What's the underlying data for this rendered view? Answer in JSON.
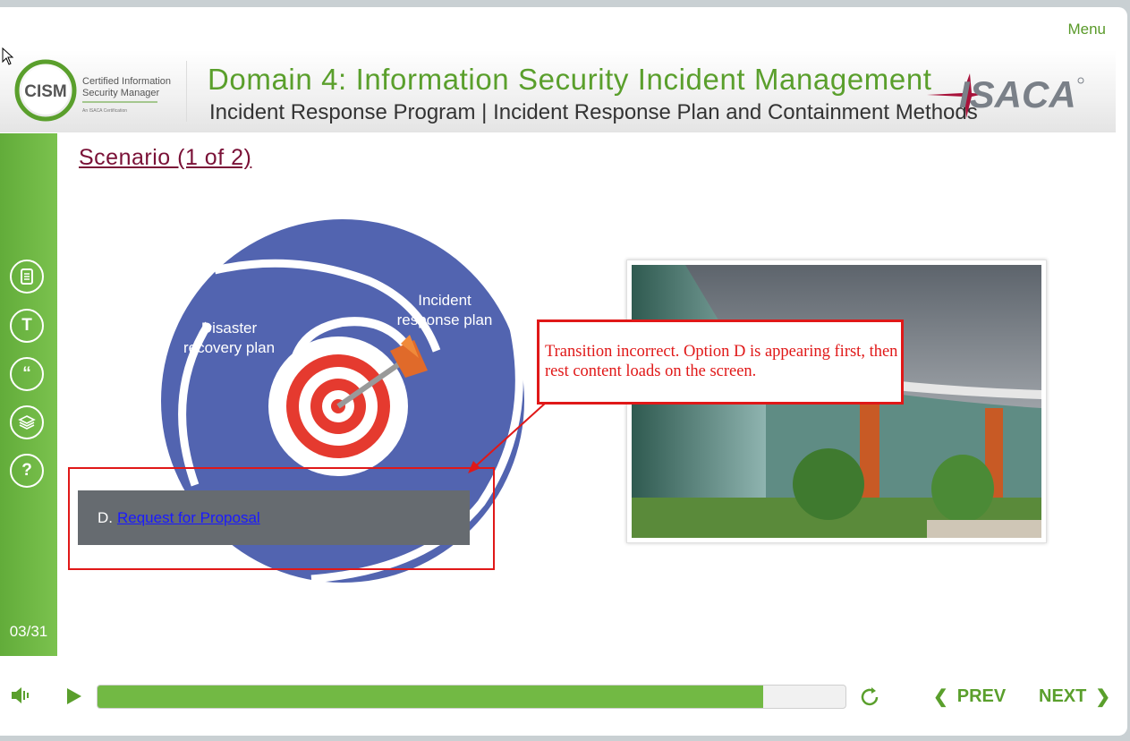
{
  "header": {
    "menu_label": "Menu",
    "logo_acronym": "CISM",
    "logo_line1": "Certified Information",
    "logo_line2": "Security Manager",
    "logo_tagline": "An ISACA Certification",
    "domain_title": "Domain 4: Information Security Incident Management",
    "sub_title": "Incident Response Program | Incident Response Plan and Containment Methods",
    "brand_logo": "ISACA"
  },
  "sidebar": {
    "buttons": [
      {
        "icon": "notes-icon"
      },
      {
        "icon": "transcript-icon",
        "glyph": "T"
      },
      {
        "icon": "quote-icon",
        "glyph": "“"
      },
      {
        "icon": "layers-icon"
      },
      {
        "icon": "help-icon",
        "glyph": "?"
      }
    ],
    "slide_counter": "03/31"
  },
  "slide": {
    "title": "Scenario (1 of 2)",
    "diagram": {
      "label_dr": "Disaster recovery plan",
      "label_ir": "Incident response plan",
      "color": "#5264b0"
    },
    "option": {
      "letter": "D.",
      "text": "Request for Proposal"
    },
    "annotation": "Transition incorrect. Option D is appearing first, then rest content loads on the screen.",
    "annotation_color": "#e01818"
  },
  "controls": {
    "progress_fraction": 0.89,
    "prev_label": "PREV",
    "next_label": "NEXT",
    "accent_color": "#5a9f2c"
  }
}
